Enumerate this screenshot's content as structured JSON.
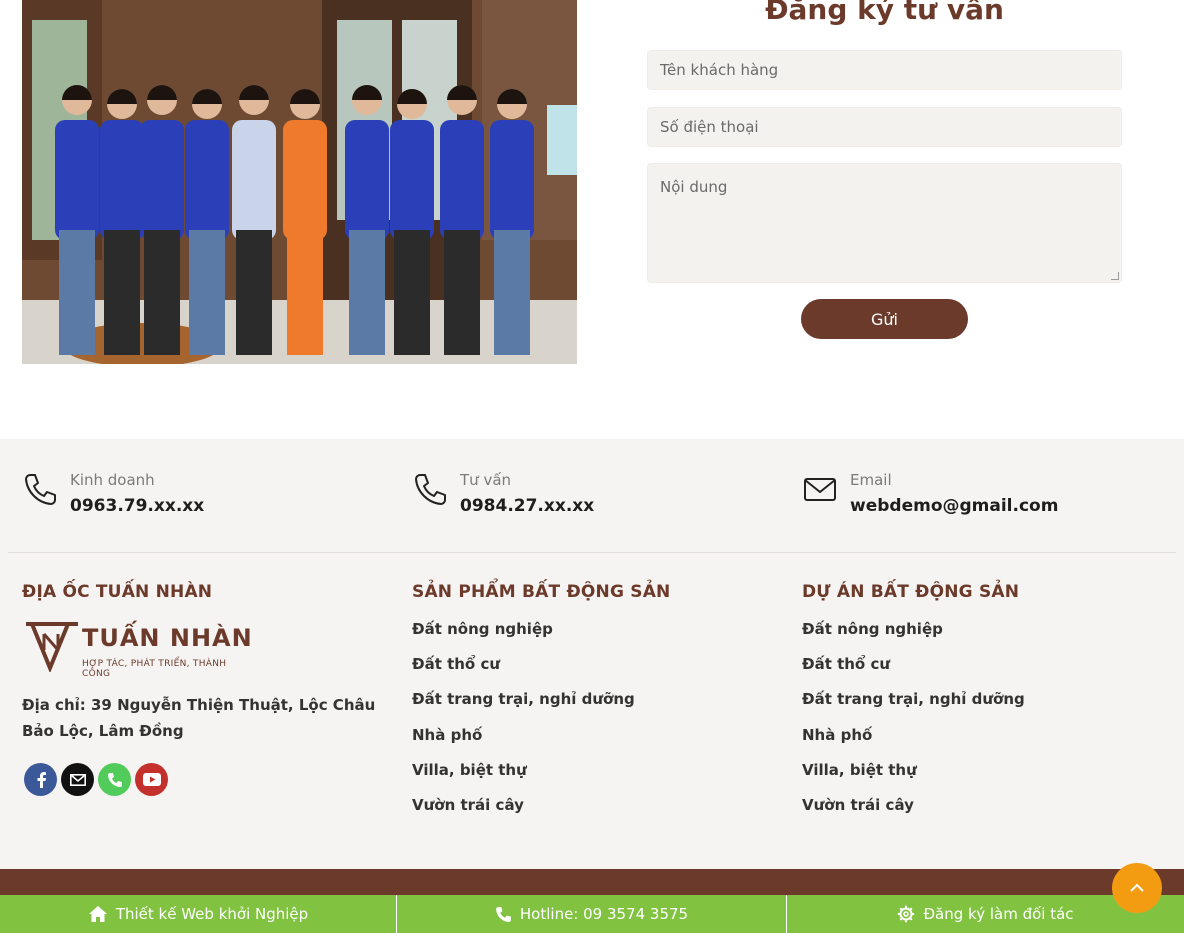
{
  "form": {
    "title": "Đăng ký tư vấn",
    "name_placeholder": "Tên khách hàng",
    "phone_placeholder": "Số điện thoại",
    "content_placeholder": "Nội dung",
    "submit_label": "Gửi"
  },
  "contacts": [
    {
      "label": "Kinh doanh",
      "value": "0963.79.xx.xx",
      "icon": "phone-icon"
    },
    {
      "label": "Tư vấn",
      "value": "0984.27.xx.xx",
      "icon": "phone-icon"
    },
    {
      "label": "Email",
      "value": "webdemo@gmail.com",
      "icon": "mail-icon"
    }
  ],
  "company": {
    "heading": "ĐỊA ỐC TUẤN NHÀN",
    "logo_text": "TUẤN NHÀN",
    "logo_tagline": "HỢP TÁC, PHÁT TRIỂN, THÀNH CÔNG",
    "address": "Địa chỉ: 39 Nguyễn Thiện Thuật, Lộc Châu Bảo Lộc, Lâm Đồng"
  },
  "products": {
    "heading": "SẢN PHẨM BẤT ĐỘNG SẢN",
    "items": [
      "Đất nông nghiệp",
      "Đất thổ cư",
      "Đất trang trại, nghỉ dưỡng",
      "Nhà phố",
      "Villa, biệt thự",
      "Vườn trái cây"
    ]
  },
  "projects": {
    "heading": "DỰ ÁN BẤT ĐỘNG SẢN",
    "items": [
      "Đất nông nghiệp",
      "Đất thổ cư",
      "Đất trang trại, nghỉ dưỡng",
      "Nhà phố",
      "Villa, biệt thự",
      "Vườn trái cây"
    ]
  },
  "bottom_bar": {
    "item1": "Thiết kế Web khởi Nghiệp",
    "item2": "Hotline: 09 3574 3575",
    "item3": "Đăng ký làm đối tác"
  },
  "colors": {
    "brand_brown": "#6b3a2a",
    "green_bar": "#81c341",
    "back_to_top": "#f39c12"
  }
}
